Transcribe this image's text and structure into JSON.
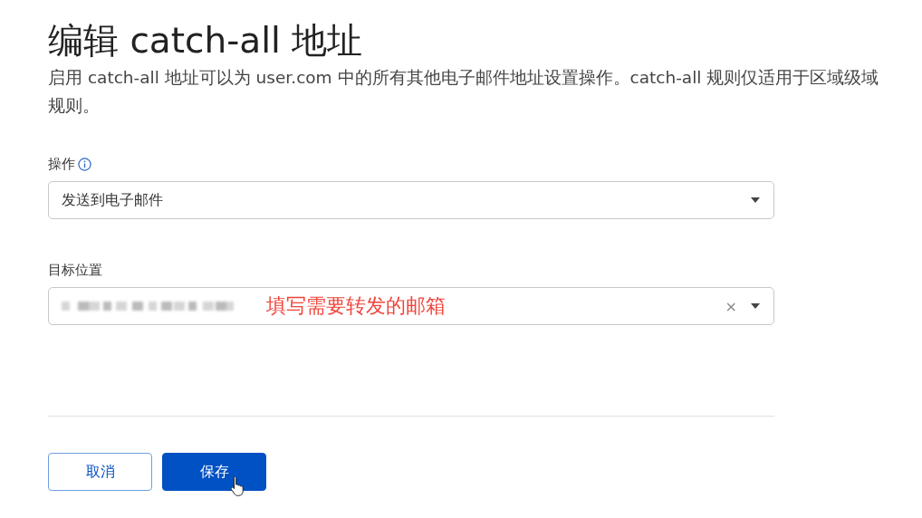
{
  "title": "编辑 catch-all 地址",
  "description": [
    "启用 catch-all 地址可以为 user.com 中的所有其他电子邮件地址设置操作。catch-all 规则仅适用于区域级域",
    "规则。"
  ],
  "fields": [
    {
      "label": "操作",
      "info": true,
      "value": "发送到电子邮件"
    },
    {
      "label": "目标位置",
      "redacted": true,
      "annotation": "填写需要转发的邮箱",
      "clear": "×"
    }
  ],
  "buttons": [
    {
      "label": "取消",
      "primary": false
    },
    {
      "label": "保存",
      "primary": true,
      "hovered": true
    }
  ]
}
